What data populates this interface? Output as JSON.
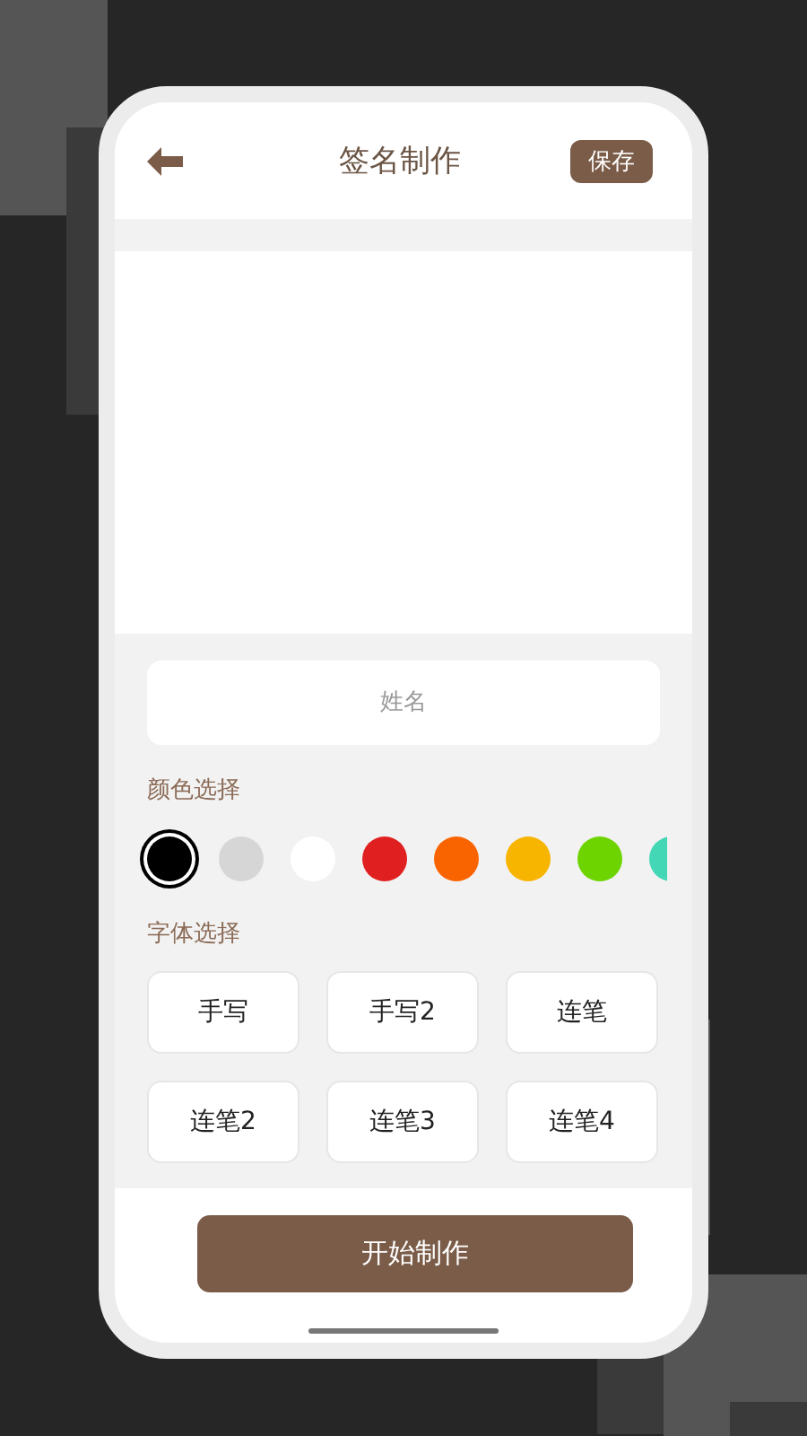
{
  "header": {
    "title": "签名制作",
    "save_button": "保存"
  },
  "name_field": {
    "placeholder": "姓名"
  },
  "color_section": {
    "label": "颜色选择",
    "colors": [
      {
        "color": "#000000",
        "selected": true
      },
      {
        "color": "#d6d6d6",
        "selected": false
      },
      {
        "color": "#ffffff",
        "selected": false
      },
      {
        "color": "#e02020",
        "selected": false
      },
      {
        "color": "#fa6400",
        "selected": false
      },
      {
        "color": "#f7b500",
        "selected": false
      },
      {
        "color": "#6dd400",
        "selected": false
      },
      {
        "color": "#44d7b6",
        "selected": false
      }
    ]
  },
  "font_section": {
    "label": "字体选择",
    "fonts": [
      "手写",
      "手写2",
      "连笔",
      "连笔2",
      "连笔3",
      "连笔4"
    ]
  },
  "start_button": "开始制作"
}
